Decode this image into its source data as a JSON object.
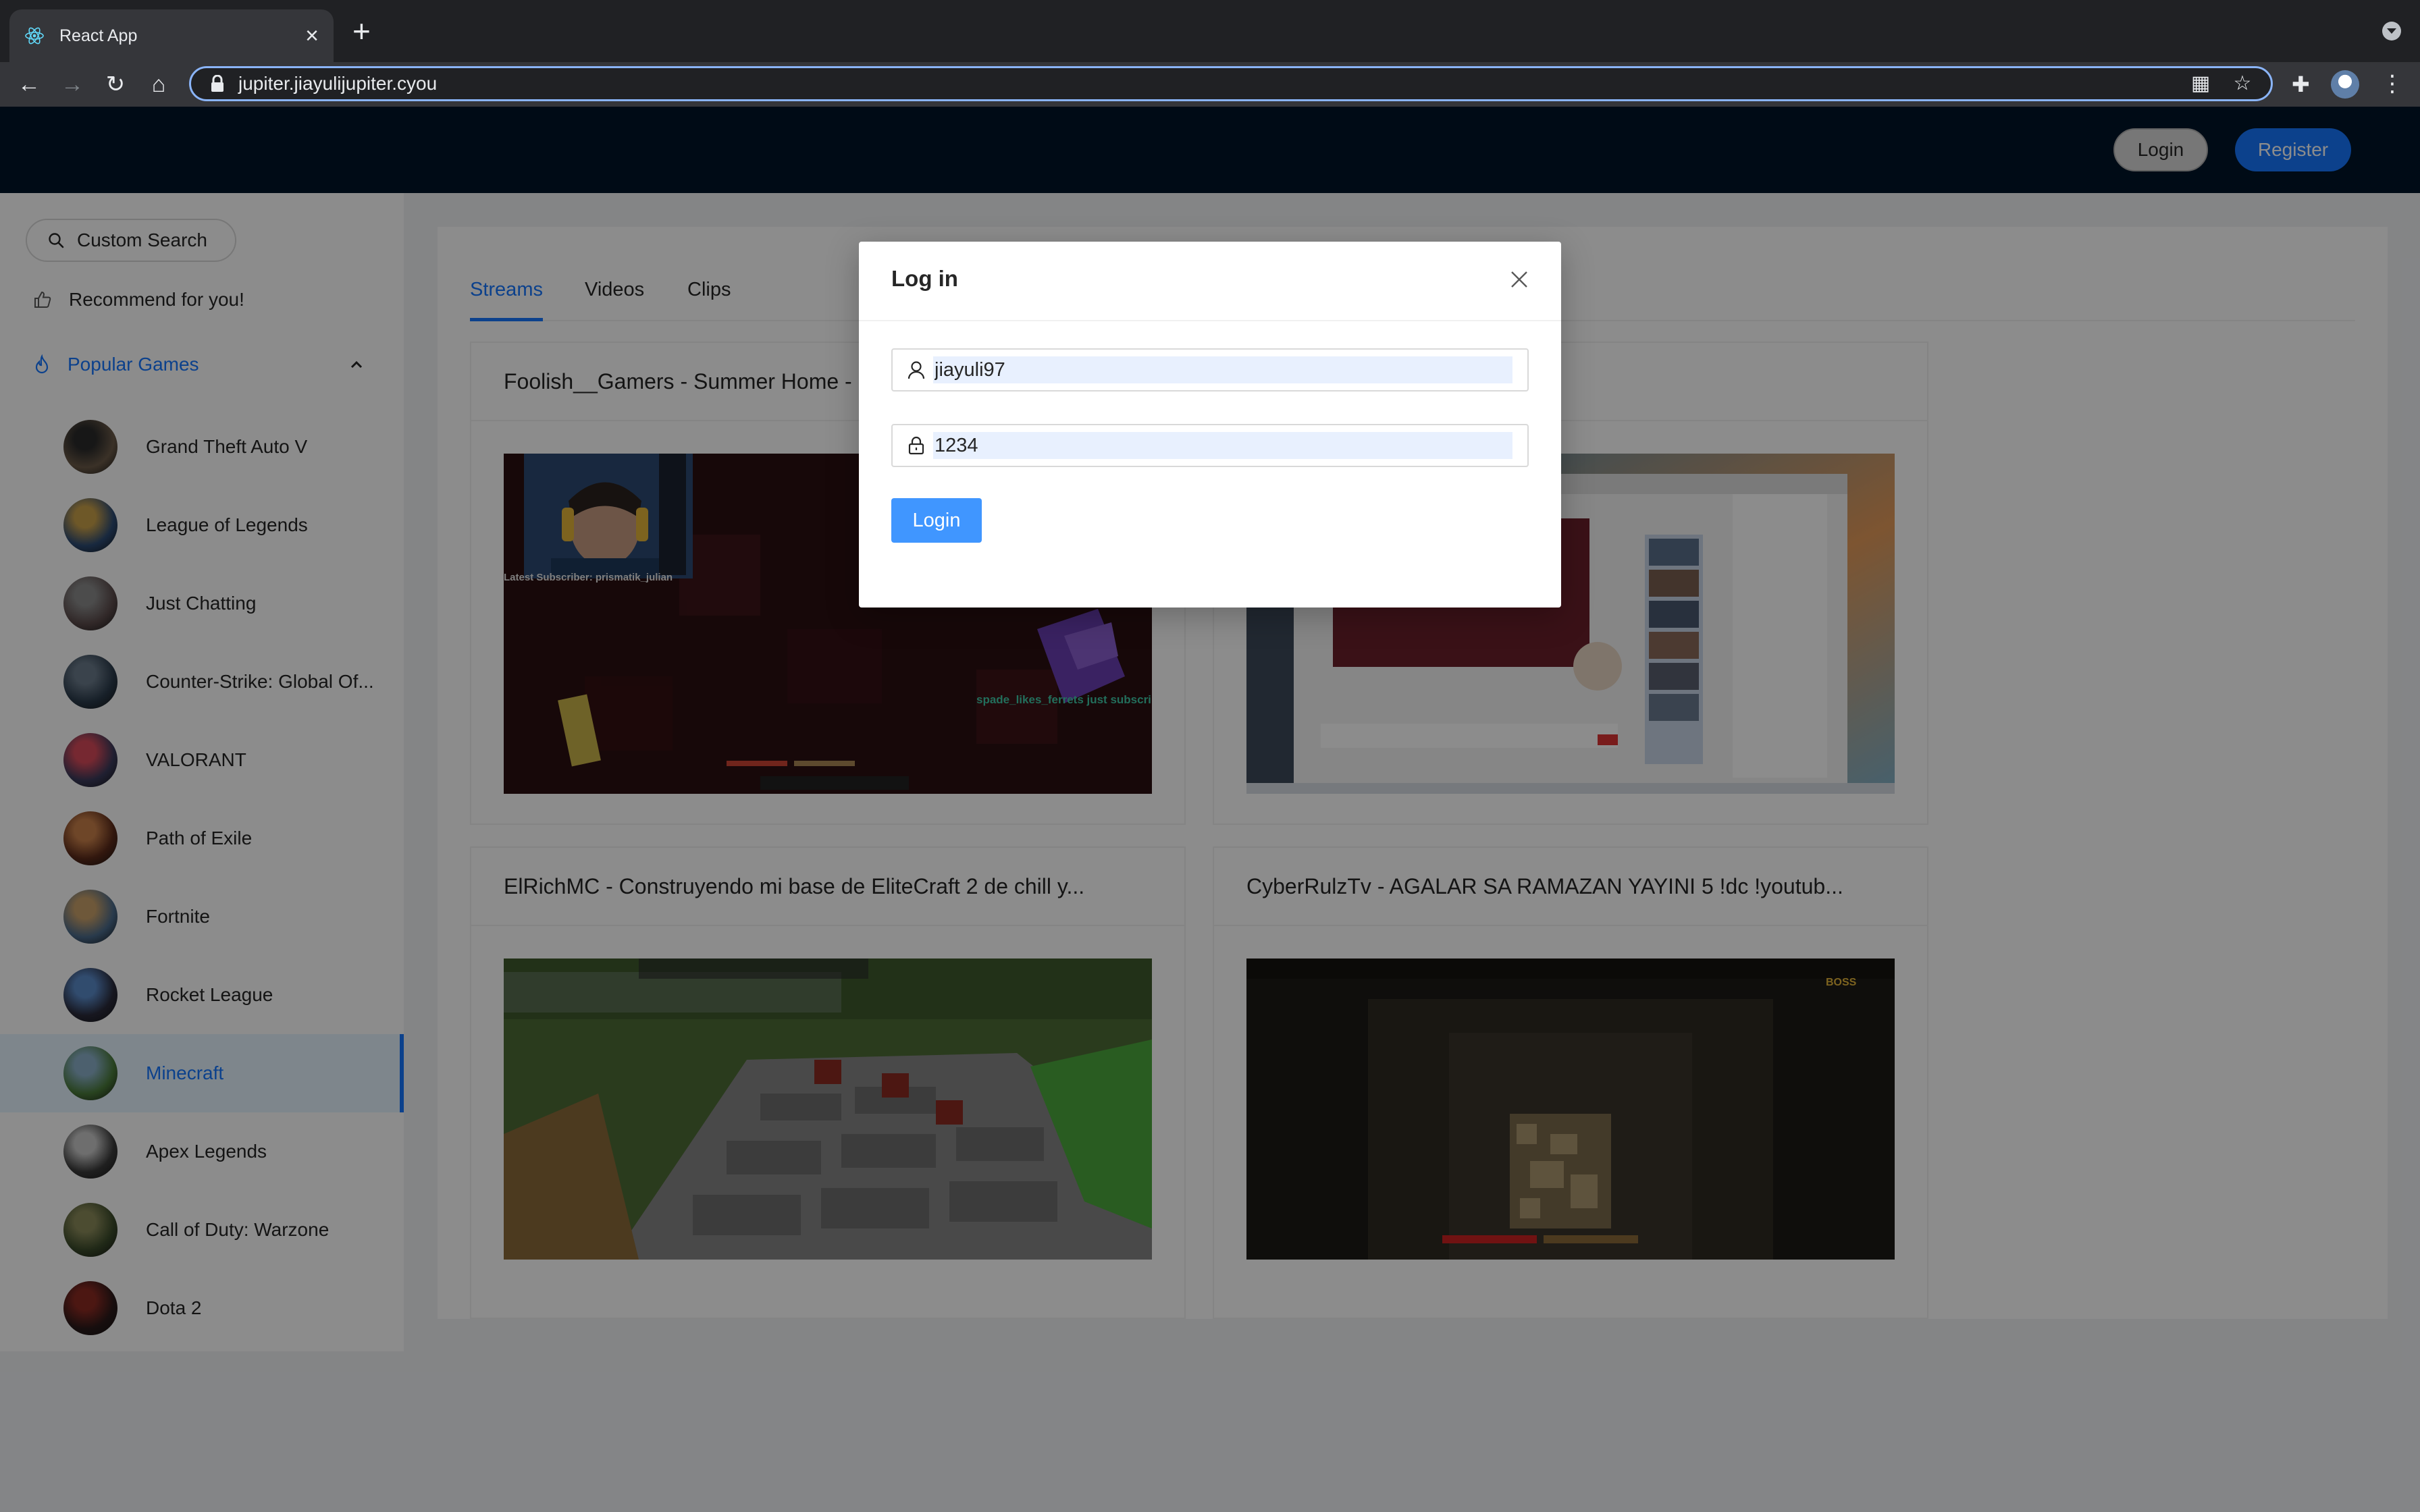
{
  "browser": {
    "tab_title": "React App",
    "url": "jupiter.jiayulijupiter.cyou"
  },
  "header": {
    "login_label": "Login",
    "register_label": "Register",
    "colors": {
      "background": "#001529",
      "primary": "#1677ff"
    }
  },
  "sidebar": {
    "search_label": "Custom Search",
    "recommend_label": "Recommend for you!",
    "popular_label": "Popular Games",
    "selected_game": "Minecraft",
    "games": [
      "Grand Theft Auto V",
      "League of Legends",
      "Just Chatting",
      "Counter-Strike: Global Of...",
      "VALORANT",
      "Path of Exile",
      "Fortnite",
      "Rocket League",
      "Minecraft",
      "Apex Legends",
      "Call of Duty: Warzone",
      "Dota 2"
    ]
  },
  "content": {
    "tabs": [
      "Streams",
      "Videos",
      "Clips"
    ],
    "active_tab": "Streams",
    "cards": [
      {
        "title": "Foolish__Gamers - Summer Home -",
        "thumb_overlay": [
          "Latest Subscriber: prismatik_julian",
          "spade_likes_ferrets just subscribed!"
        ]
      },
      {
        "title": "",
        "thumb_overlay": []
      },
      {
        "title": "ElRichMC - Construyendo mi base de EliteCraft 2 de chill y...",
        "thumb_overlay": []
      },
      {
        "title": "CyberRulzTv - AGALAR SA RAMAZAN YAYINI 5 !dc !youtub...",
        "thumb_overlay": [
          "BOSS"
        ]
      }
    ]
  },
  "modal": {
    "title": "Log in",
    "username_value": "jiayuli97",
    "password_value": "1234",
    "login_label": "Login"
  }
}
